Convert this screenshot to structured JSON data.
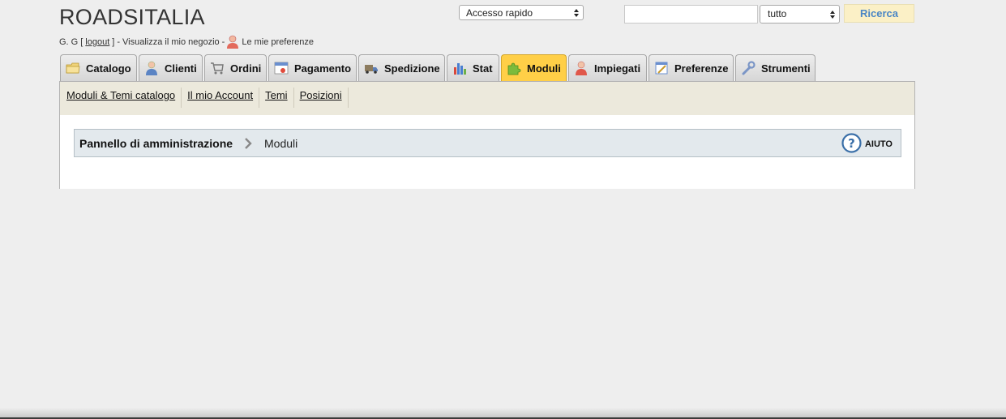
{
  "header": {
    "shop_name": "ROADSITALIA",
    "user_initials": "G. G",
    "bracket_open": "[",
    "logout_label": "logout",
    "bracket_close": "]",
    "dash1": "-",
    "view_shop_label": "Visualizza il mio negozio",
    "dash2": "-",
    "preferences_label": "Le mie preferenze"
  },
  "quick_access": {
    "selected": "Accesso rapido"
  },
  "search": {
    "value": "",
    "scope_selected": "tutto",
    "button_label": "Ricerca"
  },
  "tabs": [
    {
      "label": "Catalogo",
      "icon": "folder-icon"
    },
    {
      "label": "Clienti",
      "icon": "customer-icon"
    },
    {
      "label": "Ordini",
      "icon": "cart-icon"
    },
    {
      "label": "Pagamento",
      "icon": "payment-icon"
    },
    {
      "label": "Spedizione",
      "icon": "truck-icon"
    },
    {
      "label": "Stat",
      "icon": "bar-chart-icon"
    },
    {
      "label": "Moduli",
      "icon": "puzzle-icon",
      "active": true
    },
    {
      "label": "Impiegati",
      "icon": "employee-icon"
    },
    {
      "label": "Preferenze",
      "icon": "preferences-icon"
    },
    {
      "label": "Strumenti",
      "icon": "wrench-icon"
    }
  ],
  "subnav": [
    {
      "label": "Moduli & Temi catalogo"
    },
    {
      "label": "Il mio Account"
    },
    {
      "label": "Temi"
    },
    {
      "label": "Posizioni"
    }
  ],
  "breadcrumb": {
    "root": "Pannello di amministrazione",
    "current": "Moduli",
    "help_label": "AIUTO"
  },
  "colors": {
    "background": "#eeeeee",
    "active_tab": "#ffcf47",
    "search_button_bg": "#fbf0c6",
    "search_button_text": "#4a86c5",
    "subnav_bg": "#ece9dc",
    "breadcrumb_bg": "#e3e9ed",
    "help_icon": "#3a6fa8"
  }
}
